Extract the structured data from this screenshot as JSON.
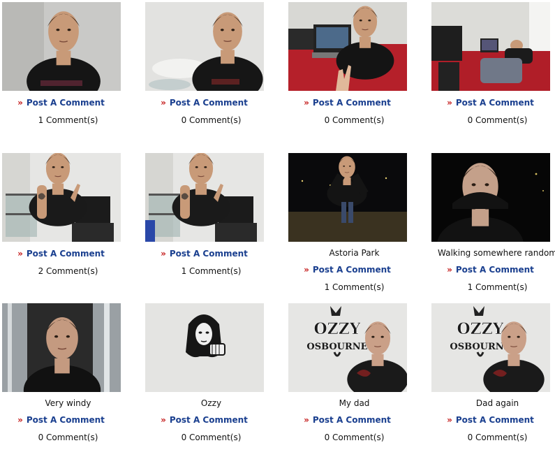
{
  "photos": [
    {
      "caption": "",
      "post_label": "Post A Comment",
      "comments": "1 Comment(s)",
      "scene": "selfie-dark"
    },
    {
      "caption": "",
      "post_label": "Post A Comment",
      "comments": "0 Comment(s)",
      "scene": "selfie-light"
    },
    {
      "caption": "",
      "post_label": "Post A Comment",
      "comments": "0 Comment(s)",
      "scene": "laptop-bed"
    },
    {
      "caption": "",
      "post_label": "Post A Comment",
      "comments": "0 Comment(s)",
      "scene": "lying-bed"
    },
    {
      "caption": "",
      "post_label": "Post A Comment",
      "comments": "2 Comment(s)",
      "scene": "tattoo-room"
    },
    {
      "caption": "",
      "post_label": "Post A Comment",
      "comments": "1 Comment(s)",
      "scene": "tattoo-room-2"
    },
    {
      "caption": "Astoria Park",
      "post_label": "Post A Comment",
      "comments": "1 Comment(s)",
      "scene": "night-park"
    },
    {
      "caption": "Walking somewhere random",
      "post_label": "Post A Comment",
      "comments": "1 Comment(s)",
      "scene": "night-close"
    },
    {
      "caption": "Very windy",
      "post_label": "Post A Comment",
      "comments": "0 Comment(s)",
      "scene": "doorway"
    },
    {
      "caption": "Ozzy",
      "post_label": "Post A Comment",
      "comments": "0 Comment(s)",
      "scene": "ozzy-poster"
    },
    {
      "caption": "My dad",
      "post_label": "Post A Comment",
      "comments": "0 Comment(s)",
      "scene": "dad-logo"
    },
    {
      "caption": "Dad again",
      "post_label": "Post A Comment",
      "comments": "0 Comment(s)",
      "scene": "dad-logo-2"
    }
  ],
  "arrow_glyph": "»",
  "logo_text": {
    "line1": "OZZY",
    "line2": "OSBOURNE"
  },
  "colors": {
    "link": "#1a3f8f",
    "arrow": "#c41a1a"
  }
}
